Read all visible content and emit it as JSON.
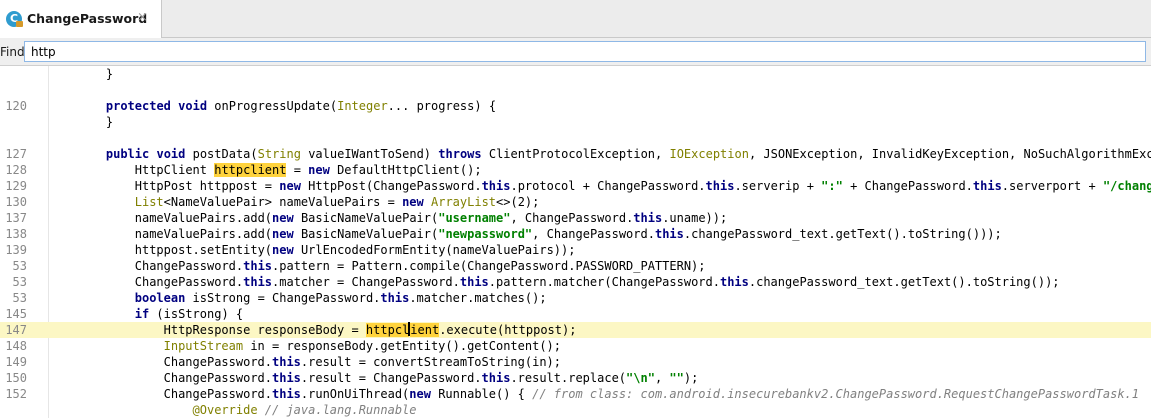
{
  "tab": {
    "icon_letter": "C",
    "title": "ChangePassword",
    "close": "×"
  },
  "find": {
    "label": "Find:",
    "value": "http"
  },
  "colors": {
    "keyword": "#000080",
    "string": "#008000",
    "type": "#808000",
    "comment": "#808080",
    "match_highlight": "#ffd33d",
    "current_line": "#fcf7c4"
  },
  "editor": {
    "lines": [
      {
        "num": "",
        "indent": 4,
        "tokens": [
          {
            "t": "}",
            "k": "p"
          }
        ]
      },
      {
        "num": "",
        "indent": 0,
        "tokens": []
      },
      {
        "num": "120",
        "indent": 4,
        "tokens": [
          {
            "t": "protected",
            "k": "k"
          },
          {
            "t": " ",
            "k": "p"
          },
          {
            "t": "void",
            "k": "k"
          },
          {
            "t": " onProgressUpdate(",
            "k": "p"
          },
          {
            "t": "Integer",
            "k": "t"
          },
          {
            "t": "... progress) {",
            "k": "p"
          }
        ]
      },
      {
        "num": "",
        "indent": 4,
        "tokens": [
          {
            "t": "}",
            "k": "p"
          }
        ]
      },
      {
        "num": "",
        "indent": 0,
        "tokens": []
      },
      {
        "num": "127",
        "indent": 4,
        "tokens": [
          {
            "t": "public",
            "k": "k"
          },
          {
            "t": " ",
            "k": "p"
          },
          {
            "t": "void",
            "k": "k"
          },
          {
            "t": " postData(",
            "k": "p"
          },
          {
            "t": "String",
            "k": "t"
          },
          {
            "t": " valueIWantToSend) ",
            "k": "p"
          },
          {
            "t": "throws",
            "k": "k"
          },
          {
            "t": " ClientProtocolException, ",
            "k": "p"
          },
          {
            "t": "IOException",
            "k": "t"
          },
          {
            "t": ", JSONException, InvalidKeyException, NoSuchAlgorithmException",
            "k": "p"
          }
        ]
      },
      {
        "num": "128",
        "indent": 8,
        "tokens": [
          {
            "t": "HttpClient ",
            "k": "p"
          },
          {
            "t": "httpclient",
            "k": "h"
          },
          {
            "t": " = ",
            "k": "p"
          },
          {
            "t": "new",
            "k": "k"
          },
          {
            "t": " DefaultHttpClient();",
            "k": "p"
          }
        ]
      },
      {
        "num": "129",
        "indent": 8,
        "tokens": [
          {
            "t": "HttpPost httppost = ",
            "k": "p"
          },
          {
            "t": "new",
            "k": "k"
          },
          {
            "t": " HttpPost(ChangePassword.",
            "k": "p"
          },
          {
            "t": "this",
            "k": "k"
          },
          {
            "t": ".protocol + ChangePassword.",
            "k": "p"
          },
          {
            "t": "this",
            "k": "k"
          },
          {
            "t": ".serverip + ",
            "k": "p"
          },
          {
            "t": "\":\"",
            "k": "s"
          },
          {
            "t": " + ChangePassword.",
            "k": "p"
          },
          {
            "t": "this",
            "k": "k"
          },
          {
            "t": ".serverport + ",
            "k": "p"
          },
          {
            "t": "\"/changepassword\"",
            "k": "s"
          }
        ]
      },
      {
        "num": "130",
        "indent": 8,
        "tokens": [
          {
            "t": "List",
            "k": "t"
          },
          {
            "t": "<NameValuePair> nameValuePairs = ",
            "k": "p"
          },
          {
            "t": "new",
            "k": "k"
          },
          {
            "t": " ",
            "k": "p"
          },
          {
            "t": "ArrayList",
            "k": "t"
          },
          {
            "t": "<>(2);",
            "k": "p"
          }
        ]
      },
      {
        "num": "137",
        "indent": 8,
        "tokens": [
          {
            "t": "nameValuePairs.add(",
            "k": "p"
          },
          {
            "t": "new",
            "k": "k"
          },
          {
            "t": " BasicNameValuePair(",
            "k": "p"
          },
          {
            "t": "\"username\"",
            "k": "s"
          },
          {
            "t": ", ChangePassword.",
            "k": "p"
          },
          {
            "t": "this",
            "k": "k"
          },
          {
            "t": ".uname));",
            "k": "p"
          }
        ]
      },
      {
        "num": "138",
        "indent": 8,
        "tokens": [
          {
            "t": "nameValuePairs.add(",
            "k": "p"
          },
          {
            "t": "new",
            "k": "k"
          },
          {
            "t": " BasicNameValuePair(",
            "k": "p"
          },
          {
            "t": "\"newpassword\"",
            "k": "s"
          },
          {
            "t": ", ChangePassword.",
            "k": "p"
          },
          {
            "t": "this",
            "k": "k"
          },
          {
            "t": ".changePassword_text.getText().toString()));",
            "k": "p"
          }
        ]
      },
      {
        "num": "139",
        "indent": 8,
        "tokens": [
          {
            "t": "httppost.setEntity(",
            "k": "p"
          },
          {
            "t": "new",
            "k": "k"
          },
          {
            "t": " UrlEncodedFormEntity(nameValuePairs));",
            "k": "p"
          }
        ]
      },
      {
        "num": "53",
        "indent": 8,
        "tokens": [
          {
            "t": "ChangePassword.",
            "k": "p"
          },
          {
            "t": "this",
            "k": "k"
          },
          {
            "t": ".pattern = Pattern.compile(ChangePassword.PASSWORD_PATTERN);",
            "k": "p"
          }
        ]
      },
      {
        "num": "53",
        "indent": 8,
        "tokens": [
          {
            "t": "ChangePassword.",
            "k": "p"
          },
          {
            "t": "this",
            "k": "k"
          },
          {
            "t": ".matcher = ChangePassword.",
            "k": "p"
          },
          {
            "t": "this",
            "k": "k"
          },
          {
            "t": ".pattern.matcher(ChangePassword.",
            "k": "p"
          },
          {
            "t": "this",
            "k": "k"
          },
          {
            "t": ".changePassword_text.getText().toString());",
            "k": "p"
          }
        ]
      },
      {
        "num": "53",
        "indent": 8,
        "tokens": [
          {
            "t": "boolean",
            "k": "k"
          },
          {
            "t": " isStrong = ChangePassword.",
            "k": "p"
          },
          {
            "t": "this",
            "k": "k"
          },
          {
            "t": ".matcher.matches();",
            "k": "p"
          }
        ]
      },
      {
        "num": "145",
        "indent": 8,
        "tokens": [
          {
            "t": "if",
            "k": "k"
          },
          {
            "t": " (isStrong) {",
            "k": "p"
          }
        ]
      },
      {
        "num": "147",
        "indent": 12,
        "current": true,
        "tokens": [
          {
            "t": "HttpResponse responseBody = ",
            "k": "p"
          },
          {
            "t": "httpcl",
            "k": "h"
          },
          {
            "t": "",
            "k": "caret"
          },
          {
            "t": "ient",
            "k": "h"
          },
          {
            "t": ".execute(httppost);",
            "k": "p"
          }
        ]
      },
      {
        "num": "148",
        "indent": 12,
        "tokens": [
          {
            "t": "InputStream",
            "k": "t"
          },
          {
            "t": " in = responseBody.getEntity().getContent();",
            "k": "p"
          }
        ]
      },
      {
        "num": "149",
        "indent": 12,
        "tokens": [
          {
            "t": "ChangePassword.",
            "k": "p"
          },
          {
            "t": "this",
            "k": "k"
          },
          {
            "t": ".result = convertStreamToString(in);",
            "k": "p"
          }
        ]
      },
      {
        "num": "150",
        "indent": 12,
        "tokens": [
          {
            "t": "ChangePassword.",
            "k": "p"
          },
          {
            "t": "this",
            "k": "k"
          },
          {
            "t": ".result = ChangePassword.",
            "k": "p"
          },
          {
            "t": "this",
            "k": "k"
          },
          {
            "t": ".result.replace(",
            "k": "p"
          },
          {
            "t": "\"\\n\"",
            "k": "s"
          },
          {
            "t": ", ",
            "k": "p"
          },
          {
            "t": "\"\"",
            "k": "s"
          },
          {
            "t": ");",
            "k": "p"
          }
        ]
      },
      {
        "num": "152",
        "indent": 12,
        "tokens": [
          {
            "t": "ChangePassword.",
            "k": "p"
          },
          {
            "t": "this",
            "k": "k"
          },
          {
            "t": ".runOnUiThread(",
            "k": "p"
          },
          {
            "t": "new",
            "k": "k"
          },
          {
            "t": " Runnable() { ",
            "k": "p"
          },
          {
            "t": "// from class: com.android.insecurebankv2.ChangePassword.RequestChangePasswordTask.1",
            "k": "c"
          }
        ]
      },
      {
        "num": "",
        "indent": 16,
        "tokens": [
          {
            "t": "@Override",
            "k": "a"
          },
          {
            "t": " ",
            "k": "p"
          },
          {
            "t": "// java.lang.Runnable",
            "k": "c"
          }
        ]
      }
    ]
  }
}
